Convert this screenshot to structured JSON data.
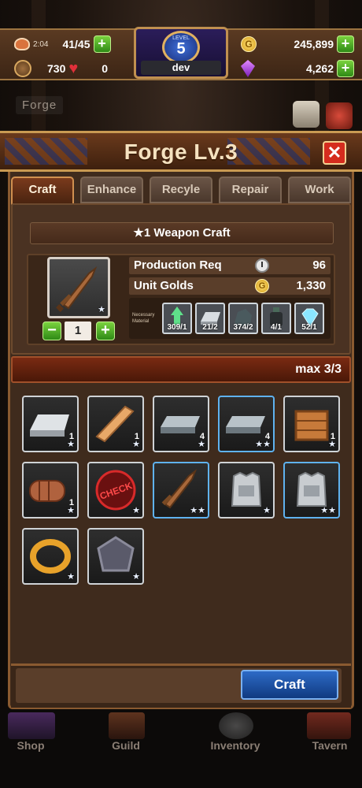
{
  "hud": {
    "timer": "2:04",
    "stamina": "41/45",
    "food": "730",
    "hearts": "0",
    "gold": "245,899",
    "gems": "4,262",
    "level_label": "LEVEL",
    "level": "5",
    "player_name": "dev",
    "plus": "+"
  },
  "scene": {
    "location_label": "Forge"
  },
  "panel": {
    "title": "Forge Lv.3",
    "close": "✕",
    "tabs": [
      "Craft",
      "Enhance",
      "Recyle",
      "Repair",
      "Work"
    ],
    "active_tab": "Craft"
  },
  "craft": {
    "banner": "★1 Weapon Craft",
    "item_star": "★",
    "quantity": "1",
    "minus": "−",
    "plus": "+",
    "production_req_label": "Production Req",
    "production_req_value": "96",
    "unit_golds_label": "Unit Golds",
    "unit_golds_value": "1,330",
    "coin_symbol": "G",
    "necessary_material_label": "Necessary Material",
    "materials": [
      {
        "name": "green-potion",
        "count": "309/1"
      },
      {
        "name": "silver-ingot",
        "count": "21/2"
      },
      {
        "name": "iron-ore",
        "count": "374/2"
      },
      {
        "name": "dark-potion",
        "count": "4/1"
      },
      {
        "name": "diamond",
        "count": "52/1"
      }
    ],
    "capacity": "max 3/3",
    "craft_button": "Craft"
  },
  "inventory": {
    "items": [
      {
        "name": "silver-ingot",
        "count": "1",
        "stars": "★",
        "highlight": false
      },
      {
        "name": "wood-plank",
        "count": "1",
        "stars": "★",
        "highlight": false
      },
      {
        "name": "iron-bar",
        "count": "4",
        "stars": "★",
        "highlight": false
      },
      {
        "name": "iron-bar",
        "count": "4",
        "stars": "★★",
        "highlight": true
      },
      {
        "name": "wooden-crate",
        "count": "1",
        "stars": "★",
        "highlight": false
      },
      {
        "name": "leather-roll",
        "count": "1",
        "stars": "★",
        "highlight": false
      },
      {
        "name": "check-stamp",
        "count": "",
        "stars": "★",
        "highlight": false
      },
      {
        "name": "wooden-sword",
        "count": "",
        "stars": "★★",
        "highlight": true
      },
      {
        "name": "steel-armor",
        "count": "",
        "stars": "★",
        "highlight": false
      },
      {
        "name": "steel-armor",
        "count": "",
        "stars": "★★",
        "highlight": true
      },
      {
        "name": "gold-ring",
        "count": "",
        "stars": "★",
        "highlight": false
      },
      {
        "name": "stone-shield",
        "count": "",
        "stars": "★",
        "highlight": false
      }
    ],
    "check_stamp_text": "CHECK"
  },
  "nav": {
    "items": [
      "Shop",
      "Guild",
      "Inventory",
      "Tavern"
    ]
  }
}
